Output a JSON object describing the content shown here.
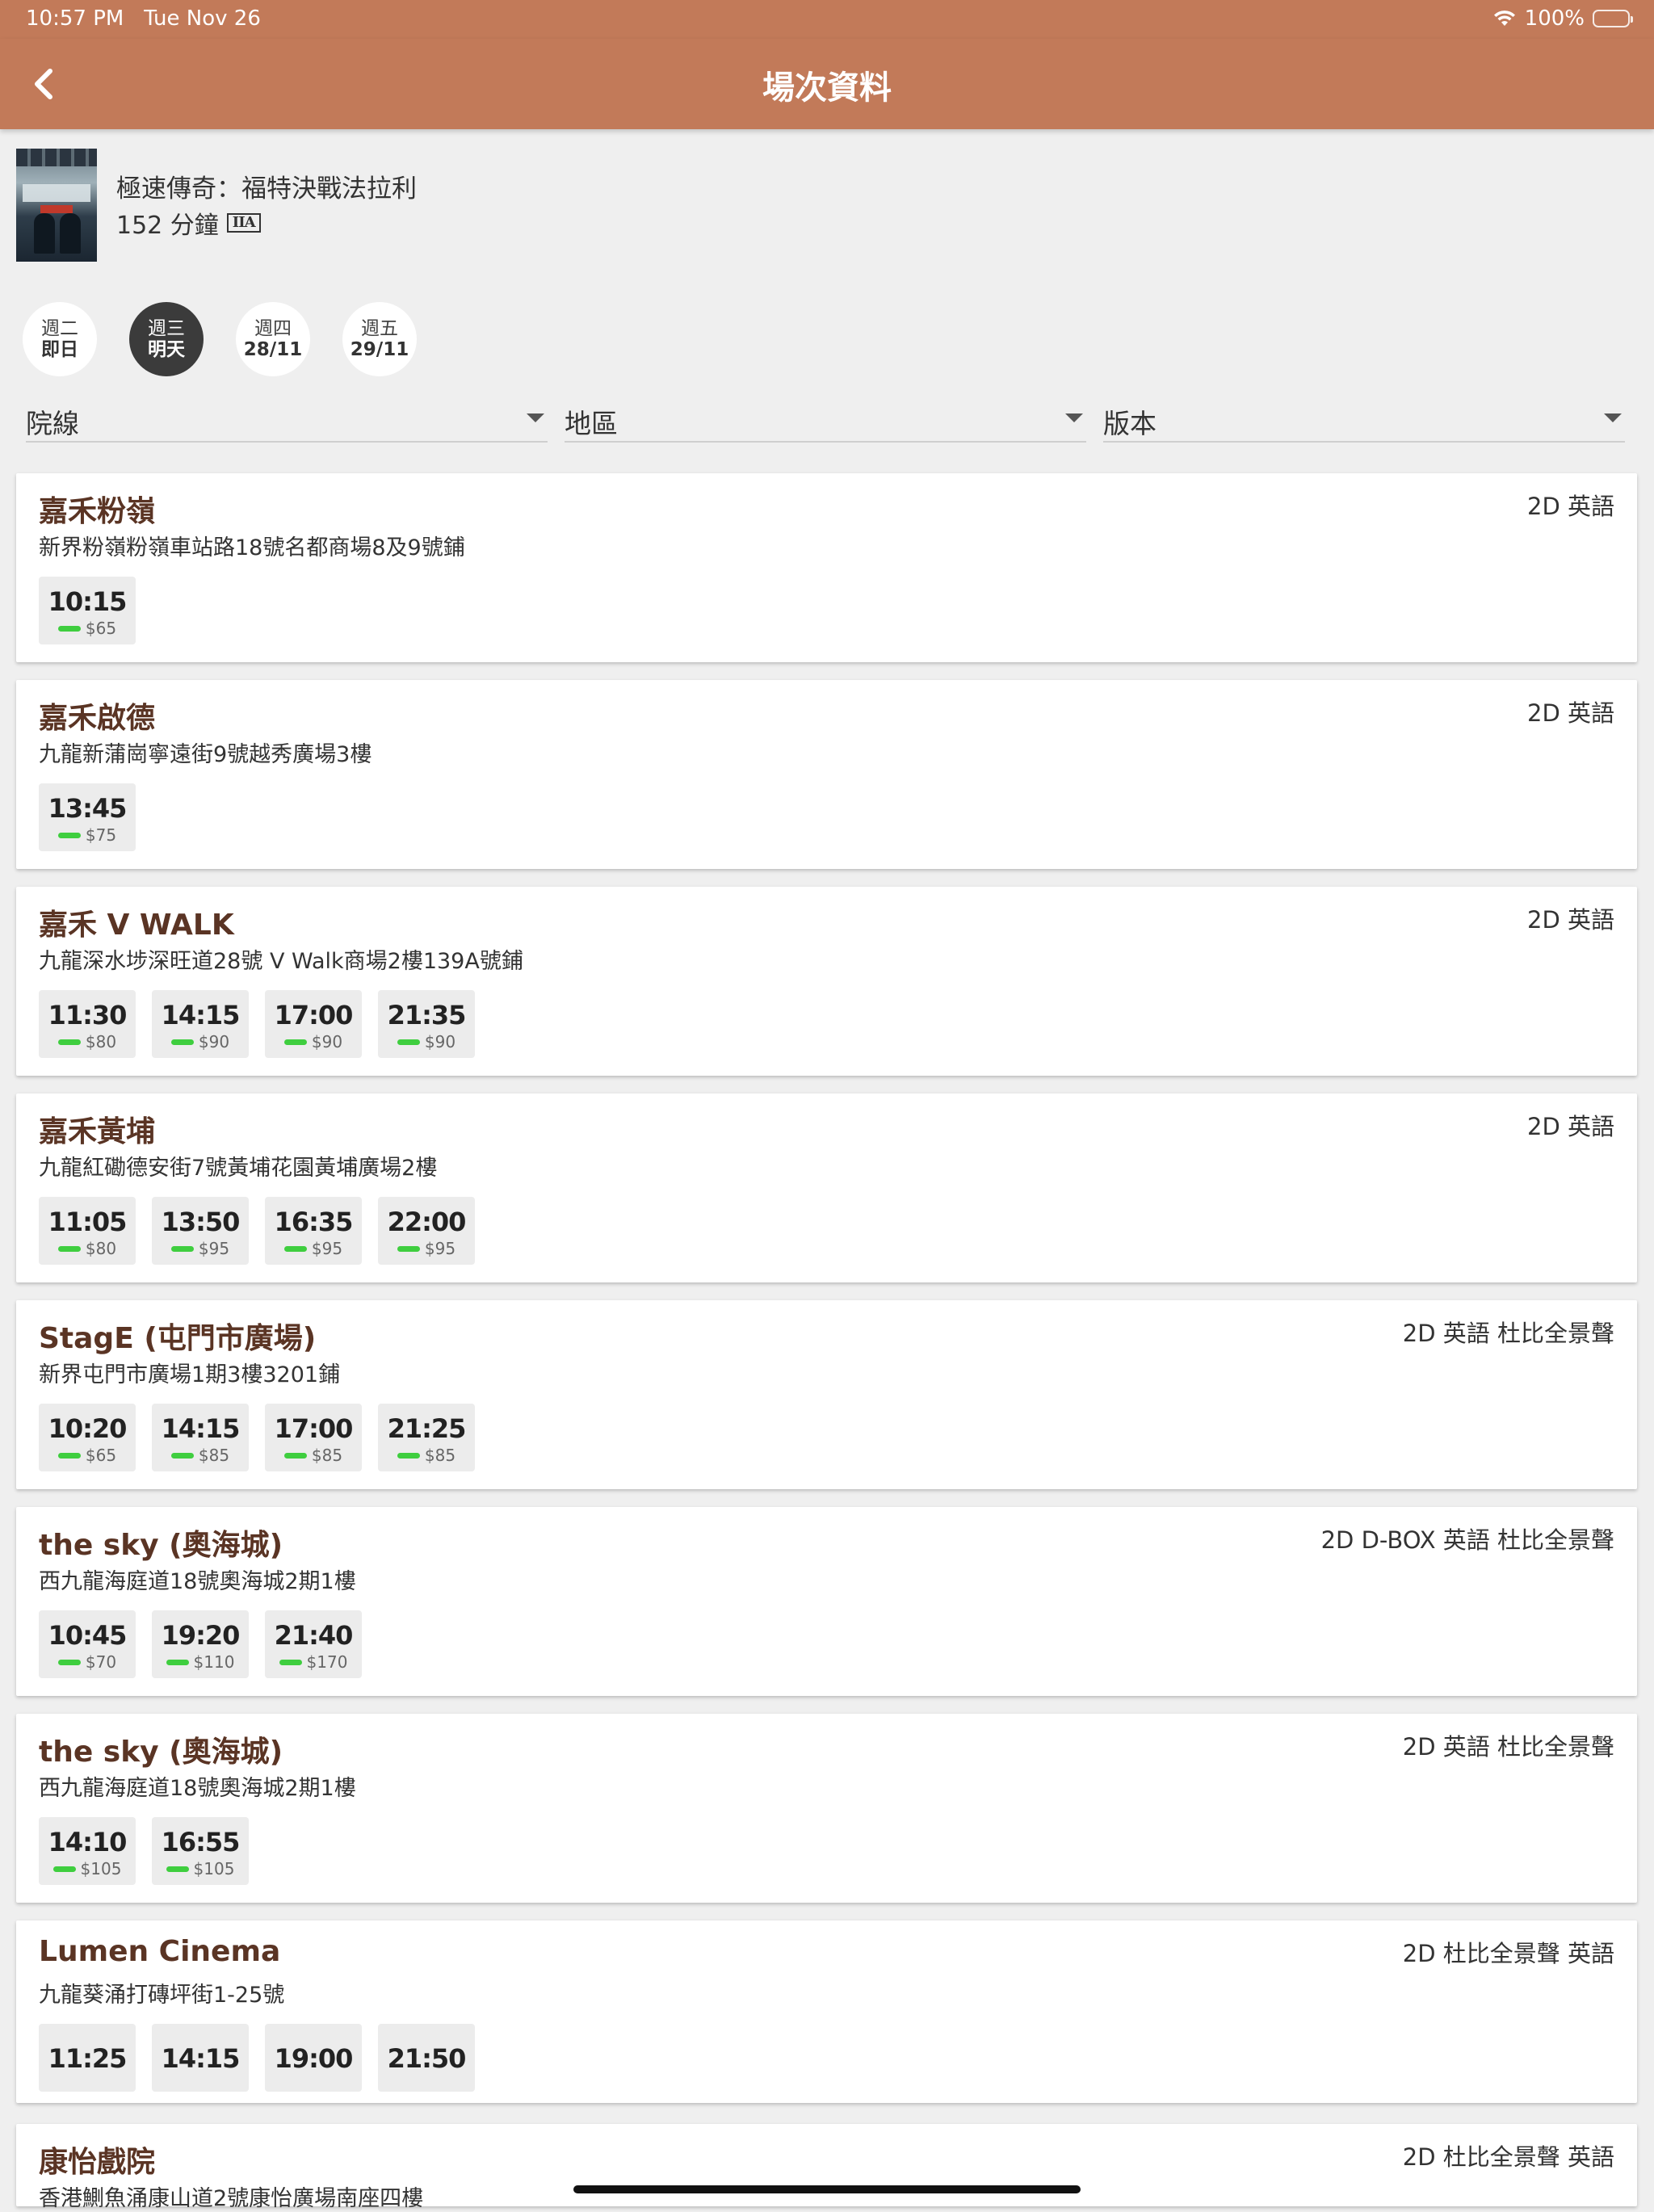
{
  "status_bar": {
    "time": "10:57 PM",
    "date": "Tue Nov 26",
    "battery": "100%"
  },
  "nav": {
    "title": "場次資料"
  },
  "movie": {
    "title": "極速傳奇：福特決戰法拉利",
    "duration": "152 分鐘",
    "rating": "IIA"
  },
  "days": [
    {
      "weekday": "週二",
      "date": "即日",
      "selected": false
    },
    {
      "weekday": "週三",
      "date": "明天",
      "selected": true
    },
    {
      "weekday": "週四",
      "date": "28/11",
      "selected": false
    },
    {
      "weekday": "週五",
      "date": "29/11",
      "selected": false
    }
  ],
  "filters": {
    "circuit": "院線",
    "district": "地區",
    "version": "版本"
  },
  "cinemas": [
    {
      "name": "嘉禾粉嶺",
      "version": "2D 英語",
      "address": "新界粉嶺粉嶺車站路18號名都商場8及9號鋪",
      "showtimes": [
        {
          "time": "10:15",
          "price": "$65"
        }
      ]
    },
    {
      "name": "嘉禾啟德",
      "version": "2D 英語",
      "address": "九龍新蒲崗寧遠街9號越秀廣場3樓",
      "showtimes": [
        {
          "time": "13:45",
          "price": "$75"
        }
      ]
    },
    {
      "name": "嘉禾 V WALK",
      "version": "2D 英語",
      "address": "九龍深水埗深旺道28號 V Walk商場2樓139A號鋪",
      "showtimes": [
        {
          "time": "11:30",
          "price": "$80"
        },
        {
          "time": "14:15",
          "price": "$90"
        },
        {
          "time": "17:00",
          "price": "$90"
        },
        {
          "time": "21:35",
          "price": "$90"
        }
      ]
    },
    {
      "name": "嘉禾黃埔",
      "version": "2D 英語",
      "address": "九龍紅磡德安街7號黃埔花園黃埔廣場2樓",
      "showtimes": [
        {
          "time": "11:05",
          "price": "$80"
        },
        {
          "time": "13:50",
          "price": "$95"
        },
        {
          "time": "16:35",
          "price": "$95"
        },
        {
          "time": "22:00",
          "price": "$95"
        }
      ]
    },
    {
      "name": "StagE (屯門市廣場)",
      "version": "2D 英語 杜比全景聲",
      "address": "新界屯門市廣場1期3樓3201鋪",
      "showtimes": [
        {
          "time": "10:20",
          "price": "$65"
        },
        {
          "time": "14:15",
          "price": "$85"
        },
        {
          "time": "17:00",
          "price": "$85"
        },
        {
          "time": "21:25",
          "price": "$85"
        }
      ]
    },
    {
      "name": "the sky (奧海城)",
      "version": "2D D-BOX 英語 杜比全景聲",
      "address": "西九龍海庭道18號奧海城2期1樓",
      "showtimes": [
        {
          "time": "10:45",
          "price": "$70"
        },
        {
          "time": "19:20",
          "price": "$110"
        },
        {
          "time": "21:40",
          "price": "$170"
        }
      ]
    },
    {
      "name": "the sky (奧海城)",
      "version": "2D 英語 杜比全景聲",
      "address": "西九龍海庭道18號奧海城2期1樓",
      "showtimes": [
        {
          "time": "14:10",
          "price": "$105"
        },
        {
          "time": "16:55",
          "price": "$105"
        }
      ]
    },
    {
      "name": "Lumen Cinema",
      "version": "2D 杜比全景聲 英語",
      "address": "九龍葵涌打磚坪街1-25號",
      "showtimes": [
        {
          "time": "11:25",
          "price": ""
        },
        {
          "time": "14:15",
          "price": ""
        },
        {
          "time": "19:00",
          "price": ""
        },
        {
          "time": "21:50",
          "price": ""
        }
      ]
    },
    {
      "name": "康怡戲院",
      "version": "2D 杜比全景聲 英語",
      "address": "香港鰂魚涌康山道2號康怡廣場南座四樓",
      "showtimes": []
    }
  ],
  "colors": {
    "header": "#c27a59",
    "cinema_name": "#5a3424",
    "availability": "#3fce3f",
    "selected_day": "#3b3b3b"
  },
  "icons": {
    "back": "chevron-left-icon",
    "wifi": "wifi-icon",
    "battery": "battery-icon",
    "dropdown": "caret-down-icon"
  }
}
